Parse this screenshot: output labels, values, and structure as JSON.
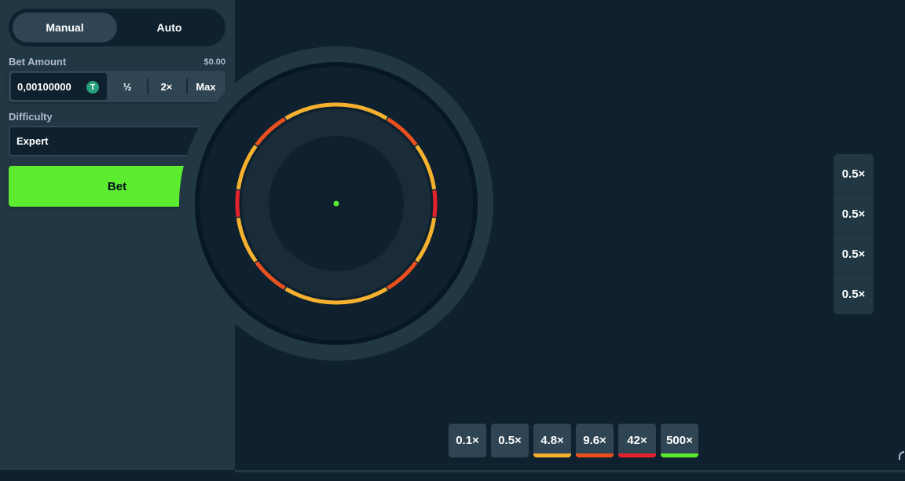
{
  "sidebar": {
    "modes": [
      {
        "label": "Manual",
        "active": true
      },
      {
        "label": "Auto",
        "active": false
      }
    ],
    "bet_amount": {
      "label": "Bet Amount",
      "usd_value": "$0.00",
      "value": "0,00100000",
      "currency_icon": "tether-icon",
      "currency_glyph": "T",
      "half_label": "½",
      "double_label": "2×",
      "max_label": "Max"
    },
    "difficulty": {
      "label": "Difficulty",
      "selected": "Expert",
      "icon": "chevron-down-icon"
    },
    "bet_button_label": "Bet"
  },
  "game": {
    "wheel": {
      "segment_colors": [
        "#f6b22e",
        "#e9501e",
        "#e8222c"
      ],
      "center_dot_color": "#5deb2f"
    },
    "side_multipliers": [
      "0.5×",
      "0.5×",
      "0.5×",
      "0.5×"
    ],
    "multiplier_chips": [
      {
        "label": "0.1×",
        "color": ""
      },
      {
        "label": "0.5×",
        "color": ""
      },
      {
        "label": "4.8×",
        "color": "#f6b22e"
      },
      {
        "label": "9.6×",
        "color": "#e9501e"
      },
      {
        "label": "42×",
        "color": "#e8222c"
      },
      {
        "label": "500×",
        "color": "#5deb2f"
      }
    ]
  },
  "colors": {
    "accent": "#5deb2f",
    "panel": "#213743",
    "background": "#0f212e"
  }
}
